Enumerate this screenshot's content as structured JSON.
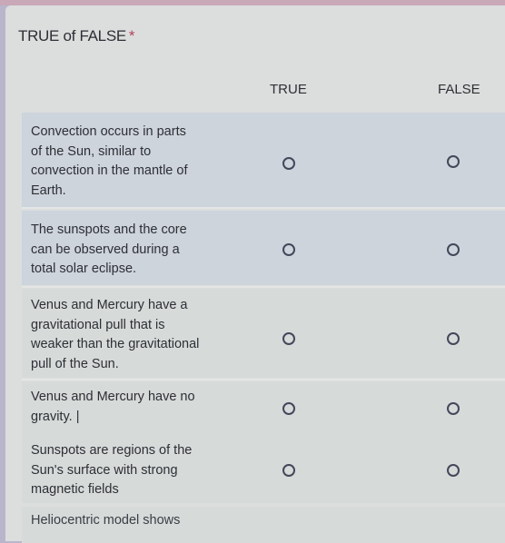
{
  "question": {
    "title": "TRUE of FALSE",
    "required_marker": "*"
  },
  "columns": [
    "TRUE",
    "FALSE"
  ],
  "rows": [
    {
      "statement": "Convection occurs in parts of the Sun, similar to convection in the mantle of Earth.",
      "lines": [
        "Convection occurs in parts",
        "of the Sun, similar to",
        "convection in the mantle of",
        "Earth."
      ],
      "selected": null
    },
    {
      "statement": "The sunspots and the core can be observed during a total solar eclipse.",
      "lines": [
        "The sunspots and the core",
        "can be observed during a",
        "total solar eclipse."
      ],
      "selected": null
    },
    {
      "statement": "Venus and Mercury have a gravitational pull that is weaker than the gravitational pull of the Sun.",
      "lines": [
        "Venus and Mercury have a",
        "gravitational pull that is",
        "weaker than the gravitational",
        "pull of the Sun."
      ],
      "selected": null
    },
    {
      "statement": "Venus and Mercury have no gravity. |",
      "lines": [
        "Venus and Mercury have no",
        "gravity. |"
      ],
      "selected": null
    },
    {
      "statement": "Sunspots are regions of the Sun's surface with strong magnetic fields",
      "lines": [
        "Sunspots are regions of the",
        "Sun's surface with strong",
        "magnetic fields"
      ],
      "selected": null
    },
    {
      "statement": "Heliocentric model shows",
      "lines": [
        "Heliocentric model shows"
      ],
      "selected": null
    }
  ],
  "colors": {
    "required": "#b4425a",
    "radio_border": "#44475a",
    "row_shade": "#cdd4dc"
  }
}
